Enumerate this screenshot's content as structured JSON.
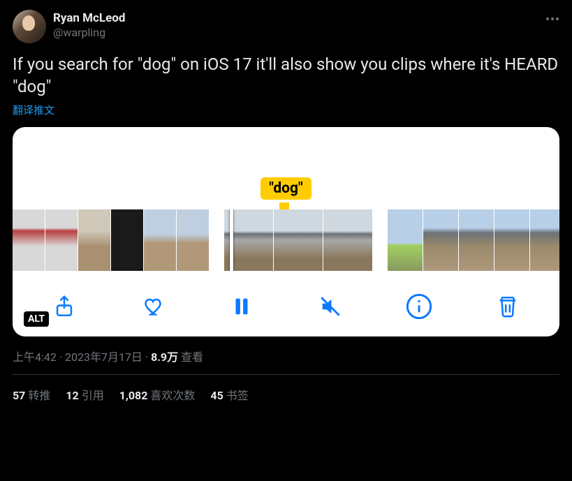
{
  "author": {
    "display_name": "Ryan McLeod",
    "handle": "@warpling"
  },
  "tweet_text": "If you search for \"dog\" on iOS 17 it'll also show you clips where it's HEARD \"dog\"",
  "translate_label": "翻译推文",
  "media": {
    "caption_bubble": "\"dog\"",
    "alt_badge": "ALT",
    "toolbar": {
      "share": "share",
      "like": "like",
      "pause": "pause",
      "mute": "mute",
      "info": "info",
      "trash": "trash"
    }
  },
  "meta": {
    "time": "上午4:42",
    "date": "2023年7月17日",
    "views_count": "8.9万",
    "views_label": "查看"
  },
  "stats": {
    "retweets_count": "57",
    "retweets_label": "转推",
    "quotes_count": "12",
    "quotes_label": "引用",
    "likes_count": "1,082",
    "likes_label": "喜欢次数",
    "bookmarks_count": "45",
    "bookmarks_label": "书签"
  },
  "more_label": "…"
}
